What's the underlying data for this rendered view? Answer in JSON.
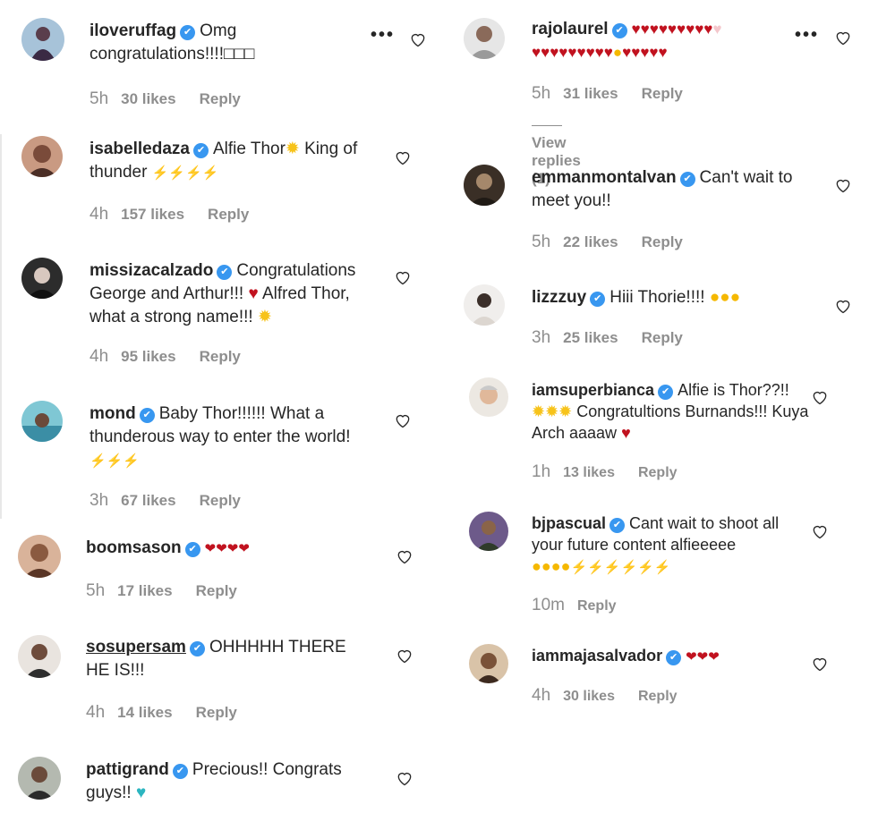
{
  "comments_left": [
    {
      "username": "iloveruffag",
      "text": "Omg congratulations!!!!□□□",
      "time": "5h",
      "likes": "30 likes",
      "reply": "Reply"
    },
    {
      "username": "isabelledaza",
      "text_a": "Alfie Thor",
      "text_b": "King of thunder",
      "time": "4h",
      "likes": "157 likes",
      "reply": "Reply"
    },
    {
      "username": "missizacalzado",
      "text_a": "Congratulations George and Arthur!!!",
      "text_b": "Alfred Thor, what a strong name!!!",
      "time": "4h",
      "likes": "95 likes",
      "reply": "Reply"
    },
    {
      "username": "mond",
      "text": "Baby Thor!!!!!! What a thunderous way to enter the world!",
      "time": "3h",
      "likes": "67 likes",
      "reply": "Reply"
    },
    {
      "username": "boomsason",
      "text": "",
      "time": "5h",
      "likes": "17 likes",
      "reply": "Reply"
    },
    {
      "username": "sosupersam",
      "text": "OHHHHH THERE HE IS!!!",
      "time": "4h",
      "likes": "14 likes",
      "reply": "Reply"
    },
    {
      "username": "pattigrand",
      "text": "Precious!! Congrats guys!!",
      "time": "",
      "likes": "",
      "reply": ""
    }
  ],
  "comments_right": [
    {
      "username": "rajolaurel",
      "text": "",
      "time": "5h",
      "likes": "31 likes",
      "reply": "Reply",
      "view_replies": "View replies (1)"
    },
    {
      "username": "emmanmontalvan",
      "text": "Can't wait to meet you!!",
      "time": "5h",
      "likes": "22 likes",
      "reply": "Reply"
    },
    {
      "username": "lizzzuy",
      "text": "Hiii Thorie!!!!",
      "time": "3h",
      "likes": "25 likes",
      "reply": "Reply"
    },
    {
      "username": "iamsuperbianca",
      "text_a": "Alfie is Thor??!!",
      "text_b": "Congratultions Burnands!!! Kuya Arch aaaaw",
      "time": "1h",
      "likes": "13 likes",
      "reply": "Reply"
    },
    {
      "username": "bjpascual",
      "text": "Cant wait to shoot all your future content alfieeeee",
      "time": "10m",
      "likes": "",
      "reply": "Reply"
    },
    {
      "username": "iammajasalvador",
      "text": "",
      "time": "4h",
      "likes": "30 likes",
      "reply": "Reply"
    }
  ],
  "icons": {
    "verified": "verified-badge-icon",
    "like": "heart-outline-icon",
    "more": "more-options-icon"
  },
  "colors": {
    "verified": "#3897f0",
    "meta": "#8e8e8e",
    "heart_emoji": "#c1121f"
  }
}
